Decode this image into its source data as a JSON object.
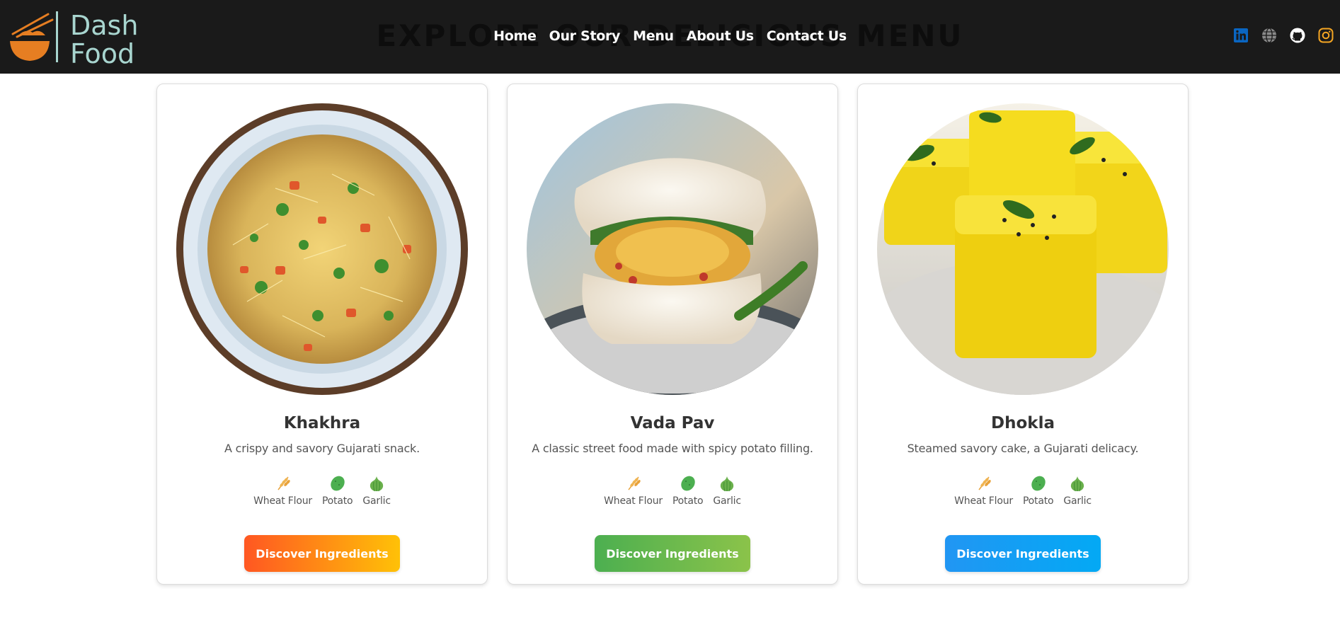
{
  "logo": {
    "line1": "Dash",
    "line2": "Food"
  },
  "background_heading": "EXPLORE OUR DELICIOUS MENU",
  "nav": {
    "items": [
      "Home",
      "Our Story",
      "Menu",
      "About Us",
      "Contact Us"
    ]
  },
  "socials": [
    {
      "icon": "linkedin-icon",
      "color": "#0a66c2"
    },
    {
      "icon": "globe-icon",
      "color": "#8a8a8a"
    },
    {
      "icon": "github-icon",
      "color": "#ffffff"
    },
    {
      "icon": "instagram-icon",
      "color": "#f5a623"
    }
  ],
  "cards": [
    {
      "title": "Khakhra",
      "description": "A crispy and savory Gujarati snack.",
      "ingredients": [
        "Wheat Flour",
        "Potato",
        "Garlic"
      ],
      "button": "Discover Ingredients",
      "button_gradient": [
        "#ff5722",
        "#ffc107"
      ]
    },
    {
      "title": "Vada Pav",
      "description": "A classic street food made with spicy potato filling.",
      "ingredients": [
        "Wheat Flour",
        "Potato",
        "Garlic"
      ],
      "button": "Discover Ingredients",
      "button_gradient": [
        "#4caf50",
        "#8bc34a"
      ]
    },
    {
      "title": "Dhokla",
      "description": "Steamed savory cake, a Gujarati delicacy.",
      "ingredients": [
        "Wheat Flour",
        "Potato",
        "Garlic"
      ],
      "button": "Discover Ingredients",
      "button_gradient": [
        "#2196f3",
        "#03a9f4"
      ]
    }
  ]
}
